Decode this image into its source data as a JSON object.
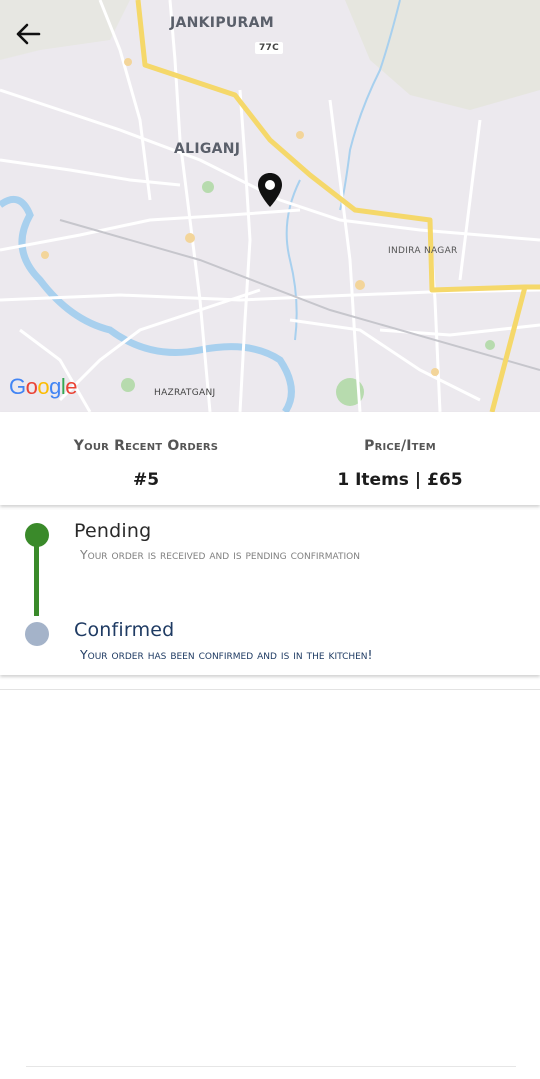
{
  "map": {
    "labels": {
      "jankipuram": "JANKIPURAM",
      "route": "77C",
      "aliganj": "ALIGANJ",
      "indira_nagar": "INDIRA NAGAR",
      "hazratganj": "HAZRATGANJ"
    },
    "attribution": "Google",
    "back_icon": "arrow-left-icon",
    "pin_icon": "map-pin-icon"
  },
  "order": {
    "recent_orders_label": "Your Recent Orders",
    "price_item_label": "Price/Item",
    "order_number": "#5",
    "items": "1 Items",
    "price": "£65"
  },
  "timeline": [
    {
      "title": "Pending",
      "description": "Your order is received and is pending confirmation"
    },
    {
      "title": "Confirmed",
      "description": "Your order has been confirmed and is in the kitchen!"
    }
  ],
  "colors": {
    "completed": "#3a8a2a",
    "upcoming": "#a4b3c9",
    "confirmed_text": "#1f3b63",
    "road_major": "#f5d86a"
  }
}
